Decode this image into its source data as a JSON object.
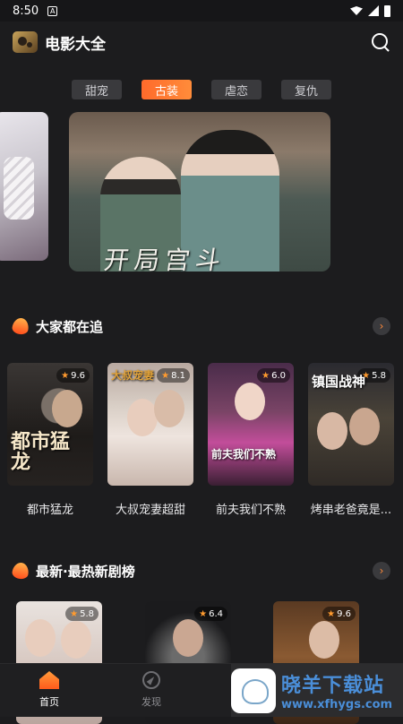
{
  "status_bar": {
    "time": "8:50",
    "notification_glyph": "A"
  },
  "app": {
    "title": "电影大全"
  },
  "tabs": [
    {
      "label": "甜宠",
      "active": false
    },
    {
      "label": "古装",
      "active": true
    },
    {
      "label": "虐恋",
      "active": false
    },
    {
      "label": "复仇",
      "active": false
    }
  ],
  "banner": {
    "overlay_text": "开局宫斗"
  },
  "section1": {
    "title": "大家都在追",
    "more_symbol": "›",
    "items": [
      {
        "title": "都市猛龙",
        "rating": "9.6",
        "poster_text": "都市猛龙"
      },
      {
        "title": "大叔宠妻超甜",
        "rating": "8.1",
        "poster_text": "大叔宠妻"
      },
      {
        "title": "前夫我们不熟",
        "rating": "6.0",
        "poster_text": "前夫我们不熟"
      },
      {
        "title": "烤串老爸竟是...",
        "rating": "5.8",
        "poster_text": "镇国战神"
      }
    ]
  },
  "section2": {
    "title": "最新·最热新剧榜",
    "more_symbol": "›",
    "items": [
      {
        "rating": "5.8"
      },
      {
        "rating": "6.4"
      },
      {
        "rating": "9.6"
      }
    ]
  },
  "bottom_nav": [
    {
      "label": "首页",
      "icon": "home-icon",
      "active": true
    },
    {
      "label": "发现",
      "icon": "compass-icon",
      "active": false
    }
  ],
  "watermark": {
    "brand": "晓羊下载站",
    "url": "www.xfhygs.com"
  },
  "colors": {
    "accent": "#ff7a2f",
    "background": "#1c1c1e",
    "watermark_blue": "#4a8ed8"
  }
}
